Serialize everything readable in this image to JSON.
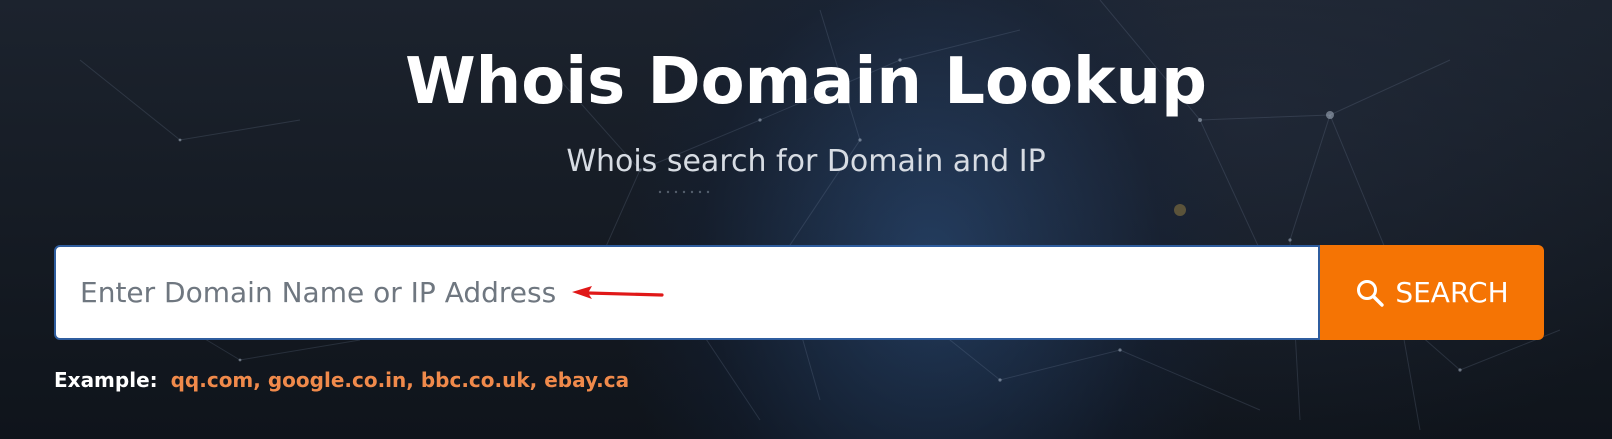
{
  "hero": {
    "title": "Whois Domain Lookup",
    "subtitle": "Whois search for Domain and IP"
  },
  "search": {
    "placeholder": "Enter Domain Name or IP Address",
    "value": "",
    "button_label": "SEARCH",
    "button_icon": "search-icon"
  },
  "examples": {
    "label": "Example:",
    "links": [
      "qq.com",
      "google.co.in",
      "bbc.co.uk",
      "ebay.ca"
    ]
  },
  "annotation": {
    "icon": "red-arrow-left-icon"
  },
  "colors": {
    "accent": "#f57404",
    "link": "#f08a4b",
    "input_border": "#2f5d9e",
    "arrow": "#e01818"
  }
}
